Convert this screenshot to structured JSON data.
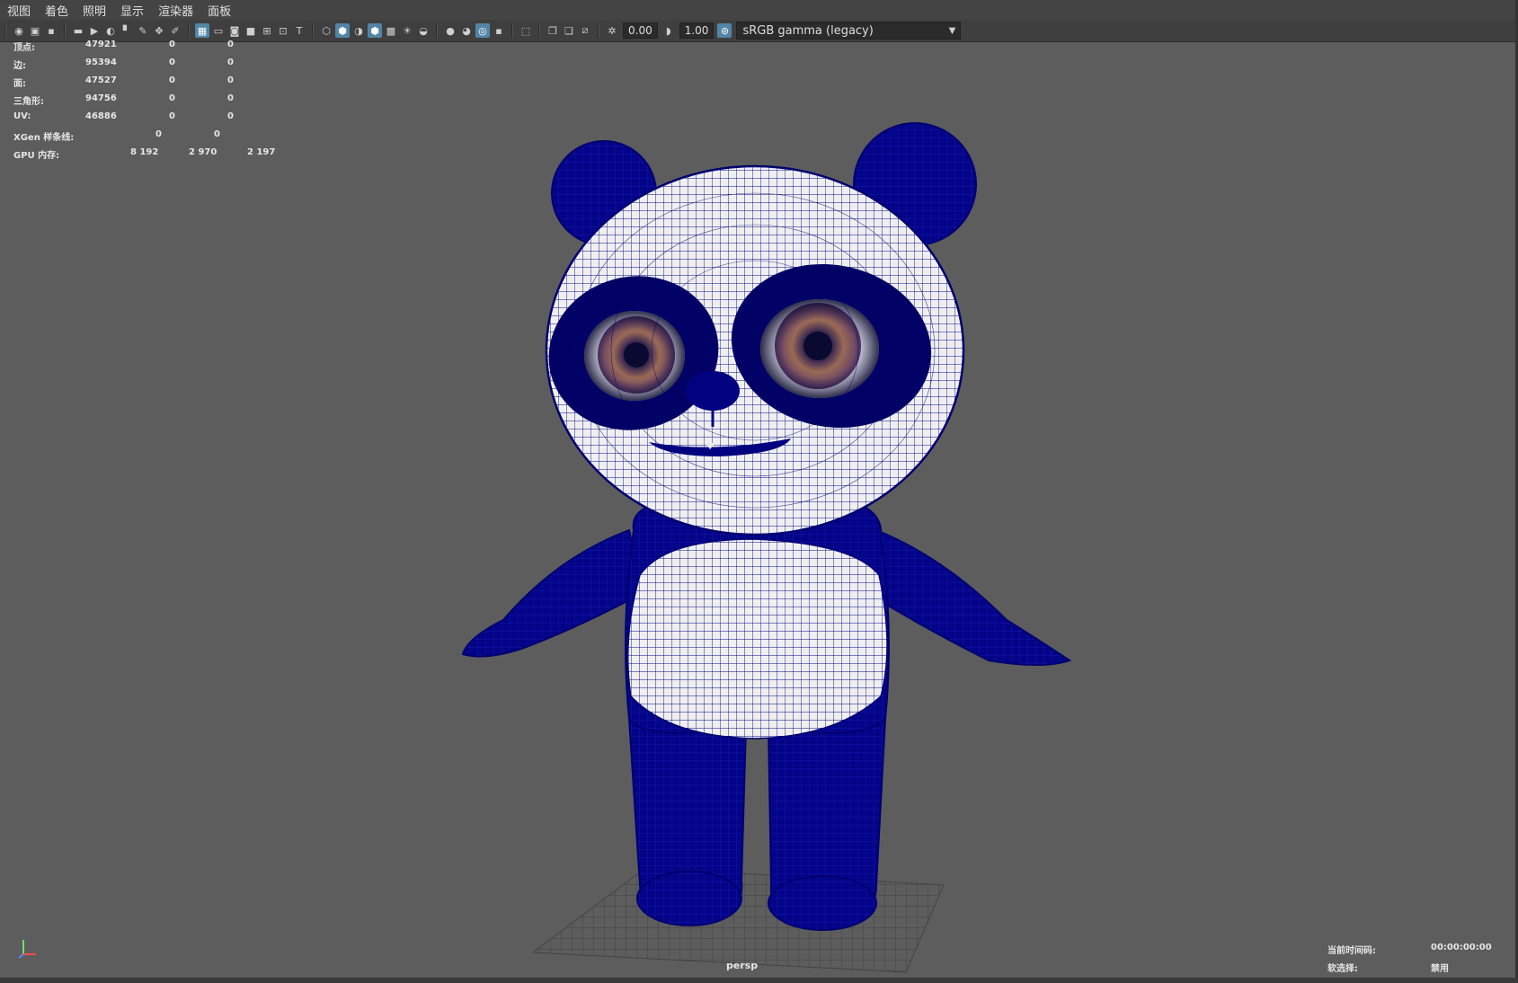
{
  "menu": [
    "视图",
    "着色",
    "照明",
    "显示",
    "渲染器",
    "面板"
  ],
  "toolbar": {
    "exposure": "0.00",
    "gamma": "1.00",
    "color_space": "sRGB gamma (legacy)"
  },
  "hud": {
    "rows": [
      {
        "label": "顶点:",
        "v1": "47921",
        "v2": "0",
        "v3": "0"
      },
      {
        "label": "边:",
        "v1": "95394",
        "v2": "0",
        "v3": "0"
      },
      {
        "label": "面:",
        "v1": "47527",
        "v2": "0",
        "v3": "0"
      },
      {
        "label": "三角形:",
        "v1": "94756",
        "v2": "0",
        "v3": "0"
      },
      {
        "label": "UV:",
        "v1": "46886",
        "v2": "0",
        "v3": "0"
      }
    ],
    "xgen": {
      "label": "XGen 样条线:",
      "v1": "0",
      "v2": "0"
    },
    "gpu": {
      "label": "GPU 内存:",
      "v1": "8 192",
      "v2": "2 970",
      "v3": "2 197"
    }
  },
  "camera_label": "persp",
  "render_info": {
    "timecode_label": "当前时间码:",
    "timecode_value": "00:00:00:00",
    "selection_label": "软选择:",
    "selection_value": "禁用"
  },
  "colors": {
    "viewport_bg": "#5d5d5d",
    "wire": "#00009c",
    "accent": "#5285a6"
  }
}
